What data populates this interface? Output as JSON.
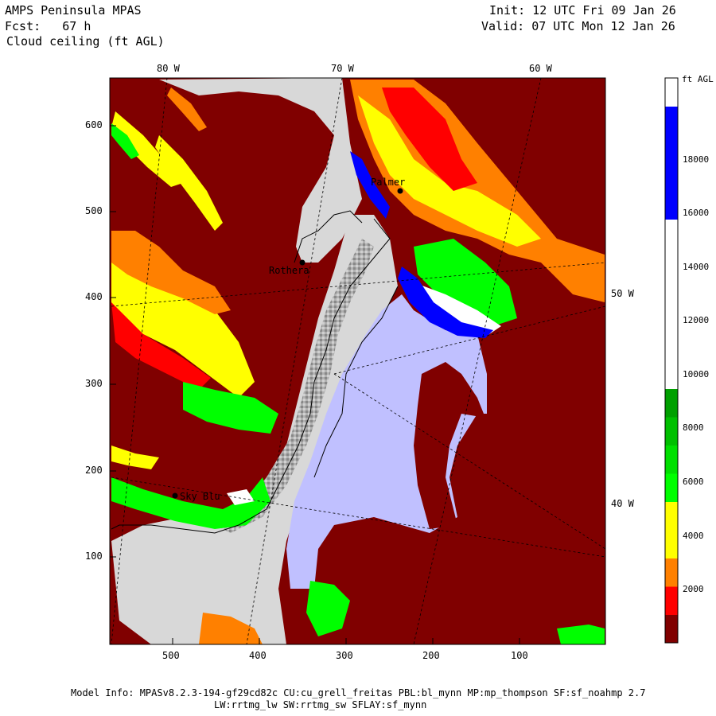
{
  "header": {
    "model": "AMPS Peninsula MPAS",
    "fcst": "Fcst:   67 h",
    "field": "Cloud ceiling (ft AGL)",
    "init": "Init: 12 UTC Fri 09 Jan 26",
    "valid": "Valid: 07 UTC Mon 12 Jan 26"
  },
  "lon_labels": {
    "top": [
      "80 W",
      "70 W",
      "60 W"
    ],
    "right": [
      "50 W",
      "40 W"
    ]
  },
  "y_axis_ticks": [
    "600",
    "500",
    "400",
    "300",
    "200",
    "100"
  ],
  "x_axis_ticks": [
    "500",
    "400",
    "300",
    "200",
    "100"
  ],
  "places": [
    "Palmer",
    "Rothera",
    "Sky Blu"
  ],
  "colorbar": {
    "unit": "ft AGL",
    "labels": [
      "18000",
      "16000",
      "14000",
      "12000",
      "10000",
      "8000",
      "6000",
      "4000",
      "2000"
    ],
    "colors": [
      "#800000",
      "#ff0000",
      "#ff8000",
      "#ffff00",
      "#ffff00",
      "#00ff00",
      "#00e000",
      "#00c000",
      "#00a000",
      "#ffffff",
      "#ffffff",
      "#ffffff",
      "#ffffff",
      "#ffffff",
      "#ffffff",
      "#0000ff",
      "#0000ff",
      "#0000ff",
      "#0000ff",
      "#ffffff"
    ],
    "thresholds": [
      0,
      1000,
      2000,
      3000,
      4000,
      5000,
      6000,
      7000,
      8000,
      9000,
      10000,
      11000,
      12000,
      13000,
      14000,
      15000,
      16000,
      17000,
      18000,
      19000,
      20000
    ]
  },
  "footer": {
    "line1": "Model Info: MPASv8.2.3-194-gf29cd82c CU:cu_grell_freitas PBL:bl_mynn MP:mp_thompson SF:sf_noahmp 2.7",
    "line2": "LW:rrtmg_lw SW:rrtmg_sw SFLAY:sf_mynn"
  },
  "colors": {
    "dark_red": "#800000",
    "red": "#ff0000",
    "orange": "#ff8000",
    "yellow": "#ffff00",
    "green": "#00ff00",
    "blue": "#0000ff",
    "sea_ice": "#c0c0ff",
    "land_grey": "#d8d8d8"
  }
}
